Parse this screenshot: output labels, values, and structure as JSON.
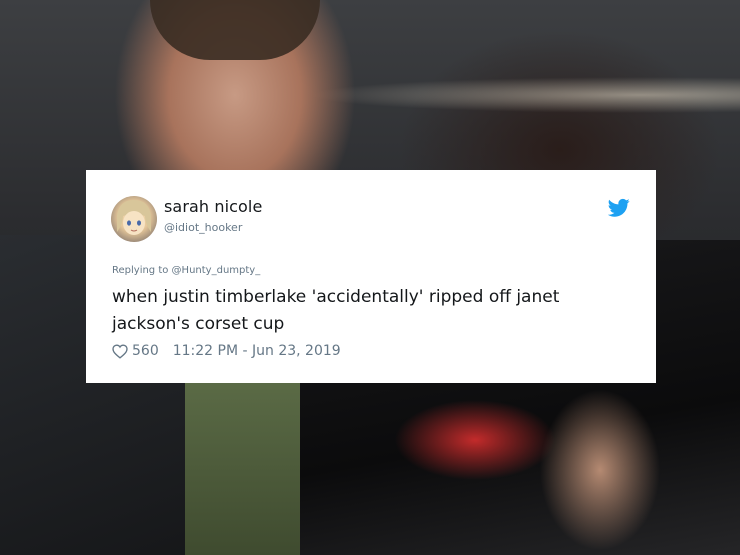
{
  "tweet": {
    "display_name": "sarah nicole",
    "handle": "@idiot_hooker",
    "replying_to": "Replying to @Hunty_dumpty_",
    "text": "when justin timberlake 'accidentally' ripped off janet jackson's corset cup",
    "likes": "560",
    "time": "11:22 PM",
    "date_separator": " - ",
    "date": "Jun 23, 2019",
    "icons": {
      "avatar": "avatar-anime-icon",
      "brand": "twitter-bird-icon",
      "like": "heart-outline-icon"
    },
    "colors": {
      "brand": "#1da1f2",
      "secondary_text": "#657786",
      "primary_text": "#14171a"
    }
  }
}
